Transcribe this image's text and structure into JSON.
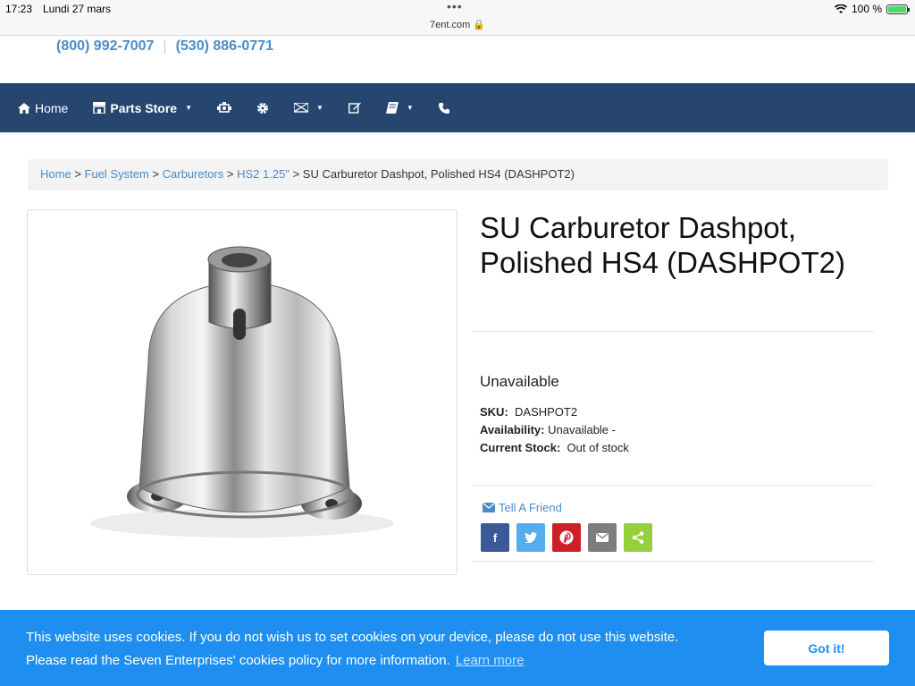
{
  "status_bar": {
    "time": "17:23",
    "date": "Lundi 27 mars",
    "url": "7ent.com 🔒",
    "battery": "100 %"
  },
  "header": {
    "phone_1": "(800) 992-7007",
    "phone_2": "(530) 886-0771"
  },
  "nav": {
    "home_label": "Home",
    "parts_store_label": "Parts Store",
    "icons": [
      "engine-icon",
      "gear-icon",
      "flag-icon",
      "edit-icon",
      "book-icon",
      "phone-icon"
    ]
  },
  "breadcrumb": {
    "home": "Home",
    "fuel_system": "Fuel System",
    "carburetors": "Carburetors",
    "hs2": "HS2 1.25\"",
    "current": "SU Carburetor Dashpot, Polished HS4 (DASHPOT2)"
  },
  "product": {
    "title": "SU Carburetor Dashpot, Polished HS4 (DASHPOT2)",
    "availability_heading": "Unavailable",
    "sku_label": "SKU:",
    "sku_value": "DASHPOT2",
    "availability_label": "Availability:",
    "availability_value": "Unavailable -",
    "stock_label": "Current Stock:",
    "stock_value": "Out of stock",
    "tell_friend": "Tell A Friend",
    "share_buttons": [
      {
        "name": "facebook",
        "glyph": "f",
        "color": "#3b5998"
      },
      {
        "name": "twitter",
        "glyph": "t",
        "color": "#55acee"
      },
      {
        "name": "pinterest",
        "glyph": "p",
        "color": "#cb2027"
      },
      {
        "name": "email",
        "glyph": "✉",
        "color": "#7d7d7d"
      },
      {
        "name": "share",
        "glyph": "<",
        "color": "#95d03a"
      }
    ]
  },
  "cookie_banner": {
    "line1": "This website uses cookies. If you do not wish us to set cookies on your device, please do not use this website.",
    "line2": "Please read the Seven Enterprises' cookies policy for more information.",
    "learn_more": "Learn more",
    "button": "Got it!"
  }
}
